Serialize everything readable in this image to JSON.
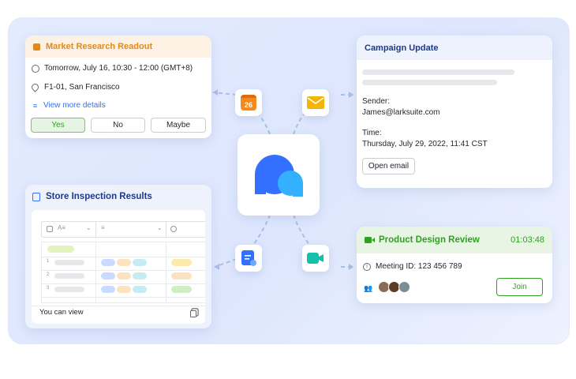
{
  "meeting_card": {
    "title": "Market Research Readout",
    "time": "Tomorrow, July 16, 10:30 - 12:00 (GMT+8)",
    "location": "F1-01, San Francisco",
    "details_link": "View more details",
    "rsvp": {
      "yes": "Yes",
      "no": "No",
      "maybe": "Maybe"
    }
  },
  "campaign_card": {
    "title": "Campaign Update",
    "sender_label": "Sender:",
    "sender_value": "James@larksuite.com",
    "time_label": "Time:",
    "time_value": "Thursday, July 29, 2022, 11:41 CST",
    "open_button": "Open email"
  },
  "inspection_card": {
    "title": "Store Inspection Results",
    "row_numbers": [
      "1",
      "2",
      "3"
    ],
    "footer": "You can view"
  },
  "video_card": {
    "title": "Product Design Review",
    "duration": "01:03:48",
    "meeting_id": "Meeting ID: 123 456 789",
    "join_button": "Join"
  },
  "icons": {
    "calendar_day": "26"
  },
  "colors": {
    "accent_blue": "#3370ff",
    "orange": "#e08a1e",
    "green": "#2ea121"
  }
}
